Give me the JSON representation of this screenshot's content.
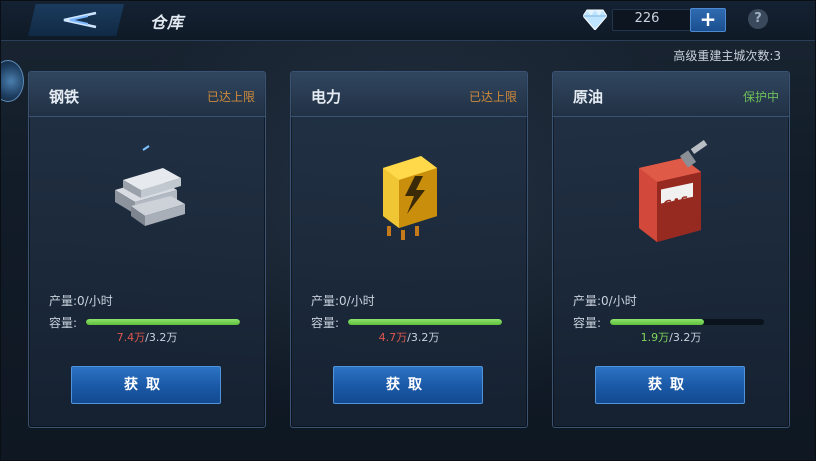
{
  "header": {
    "title": "仓库",
    "gem_count": "226",
    "plus_label": "+",
    "help_label": "?"
  },
  "rebuild_text": "高级重建主城次数:3",
  "cards": [
    {
      "name": "钢铁",
      "status": "已达上限",
      "production_label": "产量:",
      "production_value": "0/小时",
      "capacity_label": "容量:",
      "capacity_current": "7.4万",
      "capacity_max": "/3.2万",
      "capacity_fill": 1.0,
      "button_label": "获取",
      "icon": "steel-ingots-icon"
    },
    {
      "name": "电力",
      "status": "已达上限",
      "production_label": "产量:",
      "production_value": "0/小时",
      "capacity_label": "容量:",
      "capacity_current": "4.7万",
      "capacity_max": "/3.2万",
      "capacity_fill": 1.0,
      "button_label": "获取",
      "icon": "battery-icon"
    },
    {
      "name": "原油",
      "status": "保护中",
      "production_label": "产量:",
      "production_value": "0/小时",
      "capacity_label": "容量:",
      "capacity_current": "1.9万",
      "capacity_max": "/3.2万",
      "capacity_fill": 0.61,
      "button_label": "获取",
      "icon": "gas-can-icon"
    }
  ],
  "colors": {
    "status_max": "#d08a3a",
    "status_protect": "#6fbf5a",
    "over_capacity": "#e0564d",
    "under_capacity": "#7fd35a",
    "button": "#1a58a6"
  }
}
